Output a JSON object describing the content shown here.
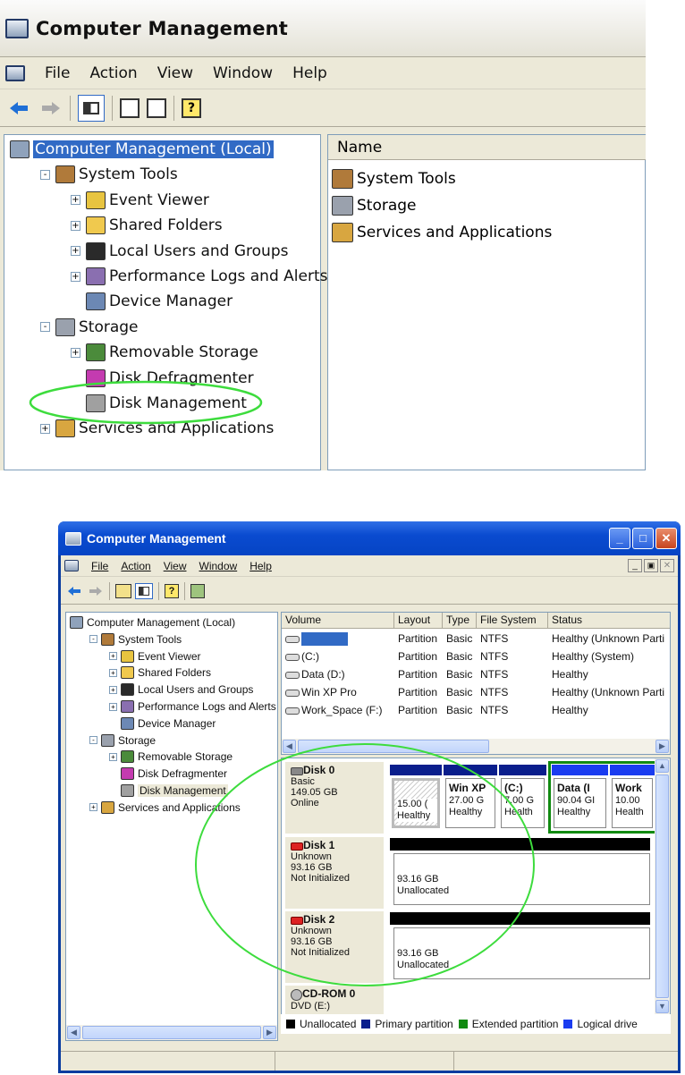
{
  "top": {
    "title": "Computer Management",
    "menu": [
      "File",
      "Action",
      "View",
      "Window",
      "Help"
    ],
    "tree": [
      {
        "label": "Computer Management (Local)",
        "level": 0,
        "expander": "",
        "icon": "computer-icon",
        "selected": true
      },
      {
        "label": "System Tools",
        "level": 1,
        "expander": "−",
        "icon": "system-tools-icon"
      },
      {
        "label": "Event Viewer",
        "level": 2,
        "expander": "+",
        "icon": "event-viewer-icon"
      },
      {
        "label": "Shared Folders",
        "level": 2,
        "expander": "+",
        "icon": "folder-icon"
      },
      {
        "label": "Local Users and Groups",
        "level": 2,
        "expander": "+",
        "icon": "users-icon"
      },
      {
        "label": "Performance Logs and Alerts",
        "level": 2,
        "expander": "+",
        "icon": "performance-icon"
      },
      {
        "label": "Device Manager",
        "level": 2,
        "expander": "",
        "icon": "device-manager-icon"
      },
      {
        "label": "Storage",
        "level": 1,
        "expander": "−",
        "icon": "storage-icon"
      },
      {
        "label": "Removable Storage",
        "level": 2,
        "expander": "+",
        "icon": "removable-storage-icon"
      },
      {
        "label": "Disk Defragmenter",
        "level": 2,
        "expander": "",
        "icon": "defrag-icon"
      },
      {
        "label": "Disk Management",
        "level": 2,
        "expander": "",
        "icon": "disk-management-icon"
      },
      {
        "label": "Services and Applications",
        "level": 1,
        "expander": "+",
        "icon": "services-icon"
      }
    ],
    "list_header": "Name",
    "list_items": [
      "System Tools",
      "Storage",
      "Services and Applications"
    ]
  },
  "bottom": {
    "title": "Computer Management",
    "menu": [
      "File",
      "Action",
      "View",
      "Window",
      "Help"
    ],
    "tree": [
      {
        "label": "Computer Management (Local)",
        "level": 0,
        "expander": ""
      },
      {
        "label": "System Tools",
        "level": 1,
        "expander": "−"
      },
      {
        "label": "Event Viewer",
        "level": 2,
        "expander": "+"
      },
      {
        "label": "Shared Folders",
        "level": 2,
        "expander": "+"
      },
      {
        "label": "Local Users and Groups",
        "level": 2,
        "expander": "+"
      },
      {
        "label": "Performance Logs and Alerts",
        "level": 2,
        "expander": "+"
      },
      {
        "label": "Device Manager",
        "level": 2,
        "expander": ""
      },
      {
        "label": "Storage",
        "level": 1,
        "expander": "−"
      },
      {
        "label": "Removable Storage",
        "level": 2,
        "expander": "+"
      },
      {
        "label": "Disk Defragmenter",
        "level": 2,
        "expander": ""
      },
      {
        "label": "Disk Management",
        "level": 2,
        "expander": "",
        "selected": true
      },
      {
        "label": "Services and Applications",
        "level": 1,
        "expander": "+"
      }
    ],
    "volume_headers": [
      "Volume",
      "Layout",
      "Type",
      "File System",
      "Status"
    ],
    "volumes": [
      {
        "volume": "",
        "layout": "Partition",
        "type": "Basic",
        "fs": "NTFS",
        "status": "Healthy (Unknown Parti"
      },
      {
        "volume": "(C:)",
        "layout": "Partition",
        "type": "Basic",
        "fs": "NTFS",
        "status": "Healthy (System)"
      },
      {
        "volume": "Data (D:)",
        "layout": "Partition",
        "type": "Basic",
        "fs": "NTFS",
        "status": "Healthy"
      },
      {
        "volume": "Win XP Pro",
        "layout": "Partition",
        "type": "Basic",
        "fs": "NTFS",
        "status": "Healthy (Unknown Parti"
      },
      {
        "volume": "Work_Space (F:)",
        "layout": "Partition",
        "type": "Basic",
        "fs": "NTFS",
        "status": "Healthy"
      }
    ],
    "disks": [
      {
        "name": "Disk 0",
        "type": "Basic",
        "size": "149.05 GB",
        "state": "Online"
      },
      {
        "name": "Disk 1",
        "type": "Unknown",
        "size": "93.16 GB",
        "state": "Not Initialized",
        "part_size": "93.16 GB",
        "part_label": "Unallocated"
      },
      {
        "name": "Disk 2",
        "type": "Unknown",
        "size": "93.16 GB",
        "state": "Not Initialized",
        "part_size": "93.16 GB",
        "part_label": "Unallocated"
      },
      {
        "name": "CD-ROM 0",
        "type": "DVD (E:)"
      }
    ],
    "disk0_parts": [
      {
        "title": "",
        "size": "15.00 (",
        "status": "Healthy"
      },
      {
        "title": "Win XP",
        "size": "27.00 G",
        "status": "Healthy"
      },
      {
        "title": "(C:)",
        "size": "7.00 G",
        "status": "Health"
      },
      {
        "title": "Data (I",
        "size": "90.04 GI",
        "status": "Healthy"
      },
      {
        "title": "Work",
        "size": "10.00",
        "status": "Health"
      }
    ],
    "legend": [
      {
        "label": "Unallocated",
        "color": "#000000"
      },
      {
        "label": "Primary partition",
        "color": "#0a1e8c"
      },
      {
        "label": "Extended partition",
        "color": "#118a11"
      },
      {
        "label": "Logical drive",
        "color": "#1a3cf0"
      }
    ],
    "annotation_color": "#3ddc3d"
  }
}
